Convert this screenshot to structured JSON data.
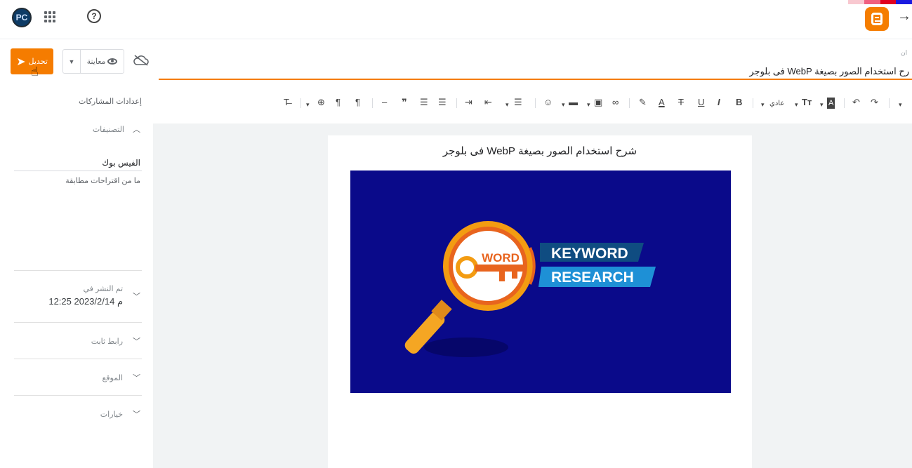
{
  "topbar": {
    "avatar_text": "PC",
    "help_glyph": "?",
    "back_glyph": "→",
    "strip_colors": [
      "#f8c8d0",
      "#f06080",
      "#e00020",
      "#1a1ae0"
    ]
  },
  "actions": {
    "publish_label": "تحديل",
    "preview_label": "معاينة"
  },
  "title": {
    "label": "ان",
    "value": "رح استخدام الصور بصيغة WebP فى بلوجر"
  },
  "toolbar": {
    "font_size_label": "عادي",
    "items": [
      "clear-format",
      "language",
      "ltr",
      "rtl",
      "hr",
      "quote",
      "numbered-list",
      "bulleted-list",
      "indent",
      "outdent",
      "align",
      "emoji",
      "video",
      "image",
      "link",
      "highlight",
      "text-color",
      "strikethrough",
      "underline",
      "italic",
      "bold",
      "font-size",
      "text-style",
      "undo",
      "redo"
    ]
  },
  "sidebar": {
    "heading": "إعدادات المشاركات",
    "labels_title": "التصنيفات",
    "label_value": "الفيس بوك",
    "label_suggestions": "ما من اقتراحات مطابقة",
    "published_title": "تم النشر في",
    "published_value": "12:25 2023/2/14 م",
    "permalink_title": "رابط ثابت",
    "location_title": "الموقع",
    "options_title": "خيارات"
  },
  "post": {
    "heading": "شرح استخدام الصور بصيغة WebP فى بلوجر",
    "image": {
      "word_text": "WORD",
      "line1": "KEYWORD",
      "line2": "RESEARCH",
      "bg_color": "#0a0a8a"
    }
  },
  "colors": {
    "accent": "#f57c00",
    "editor_bg": "#f1f3f4"
  }
}
